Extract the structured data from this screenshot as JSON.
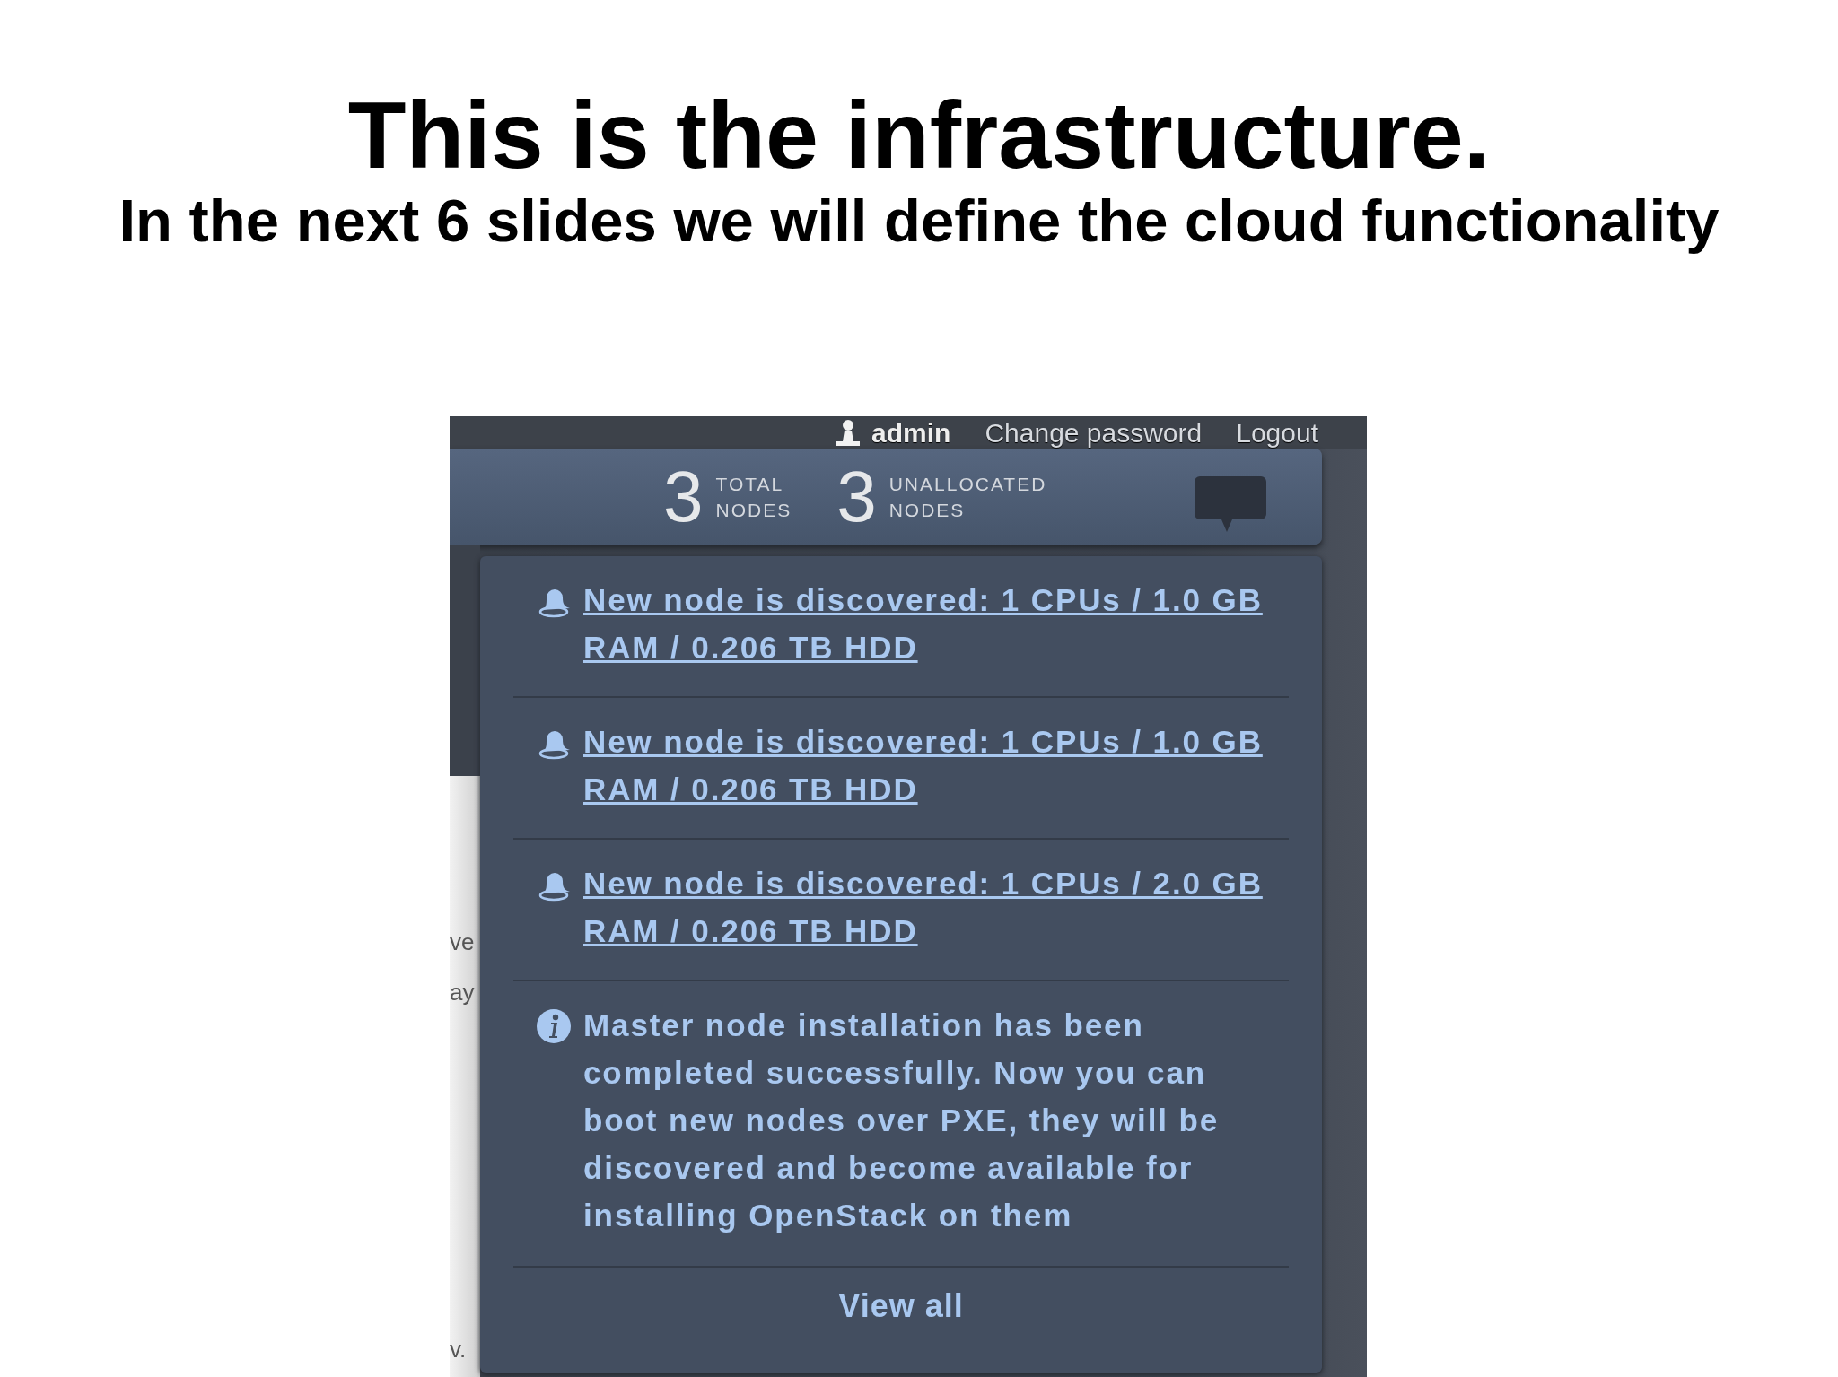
{
  "slide": {
    "title": "This is the infrastructure.",
    "subtitle": "In the next 6 slides we will define the cloud functionality"
  },
  "screenshot": {
    "user_menu": {
      "username": "admin",
      "links": [
        "Change password",
        "Logout"
      ]
    },
    "stats": [
      {
        "value": "3",
        "label": "TOTAL NODES"
      },
      {
        "value": "3",
        "label": "UNALLOCATED NODES"
      }
    ],
    "background_fragments": [
      "ve",
      "ay",
      "v."
    ],
    "notifications": [
      {
        "kind": "discovery",
        "text": "New node is discovered: 1 CPUs / 1.0 GB RAM / 0.206 TB HDD"
      },
      {
        "kind": "discovery",
        "text": "New node is discovered: 1 CPUs / 1.0 GB RAM / 0.206 TB HDD"
      },
      {
        "kind": "discovery",
        "text": "New node is discovered: 1 CPUs / 2.0 GB RAM / 0.206 TB HDD"
      },
      {
        "kind": "info",
        "text": "Master node installation has been completed successfully. Now you can boot new nodes over PXE, they will be discovered and become available for installing OpenStack on them"
      }
    ],
    "view_all": "View all"
  }
}
